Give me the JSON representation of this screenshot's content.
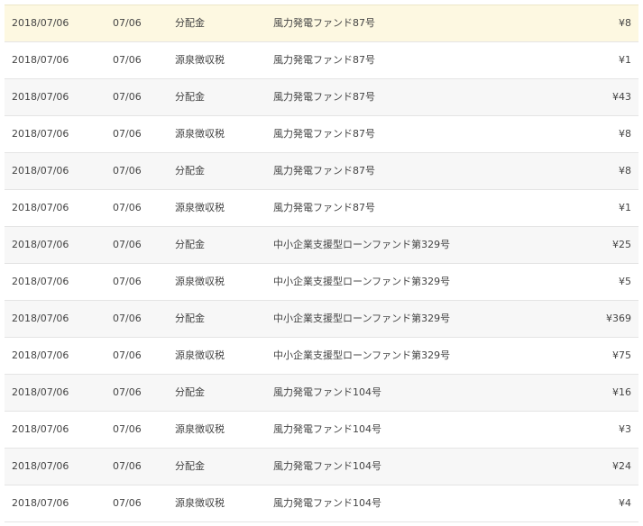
{
  "transactions": [
    {
      "date": "2018/07/06",
      "value_date": "07/06",
      "type": "分配金",
      "fund": "風力発電ファンド87号",
      "amount": "¥8"
    },
    {
      "date": "2018/07/06",
      "value_date": "07/06",
      "type": "源泉徴収税",
      "fund": "風力発電ファンド87号",
      "amount": "¥1"
    },
    {
      "date": "2018/07/06",
      "value_date": "07/06",
      "type": "分配金",
      "fund": "風力発電ファンド87号",
      "amount": "¥43"
    },
    {
      "date": "2018/07/06",
      "value_date": "07/06",
      "type": "源泉徴収税",
      "fund": "風力発電ファンド87号",
      "amount": "¥8"
    },
    {
      "date": "2018/07/06",
      "value_date": "07/06",
      "type": "分配金",
      "fund": "風力発電ファンド87号",
      "amount": "¥8"
    },
    {
      "date": "2018/07/06",
      "value_date": "07/06",
      "type": "源泉徴収税",
      "fund": "風力発電ファンド87号",
      "amount": "¥1"
    },
    {
      "date": "2018/07/06",
      "value_date": "07/06",
      "type": "分配金",
      "fund": "中小企業支援型ローンファンド第329号",
      "amount": "¥25"
    },
    {
      "date": "2018/07/06",
      "value_date": "07/06",
      "type": "源泉徴収税",
      "fund": "中小企業支援型ローンファンド第329号",
      "amount": "¥5"
    },
    {
      "date": "2018/07/06",
      "value_date": "07/06",
      "type": "分配金",
      "fund": "中小企業支援型ローンファンド第329号",
      "amount": "¥369"
    },
    {
      "date": "2018/07/06",
      "value_date": "07/06",
      "type": "源泉徴収税",
      "fund": "中小企業支援型ローンファンド第329号",
      "amount": "¥75"
    },
    {
      "date": "2018/07/06",
      "value_date": "07/06",
      "type": "分配金",
      "fund": "風力発電ファンド104号",
      "amount": "¥16"
    },
    {
      "date": "2018/07/06",
      "value_date": "07/06",
      "type": "源泉徴収税",
      "fund": "風力発電ファンド104号",
      "amount": "¥3"
    },
    {
      "date": "2018/07/06",
      "value_date": "07/06",
      "type": "分配金",
      "fund": "風力発電ファンド104号",
      "amount": "¥24"
    },
    {
      "date": "2018/07/06",
      "value_date": "07/06",
      "type": "源泉徴収税",
      "fund": "風力発電ファンド104号",
      "amount": "¥4"
    }
  ],
  "colors": {
    "highlight_row": "#fdf8e1",
    "striped_row": "#f7f7f7",
    "text": "#444444",
    "row_border": "#e4e4e4"
  }
}
